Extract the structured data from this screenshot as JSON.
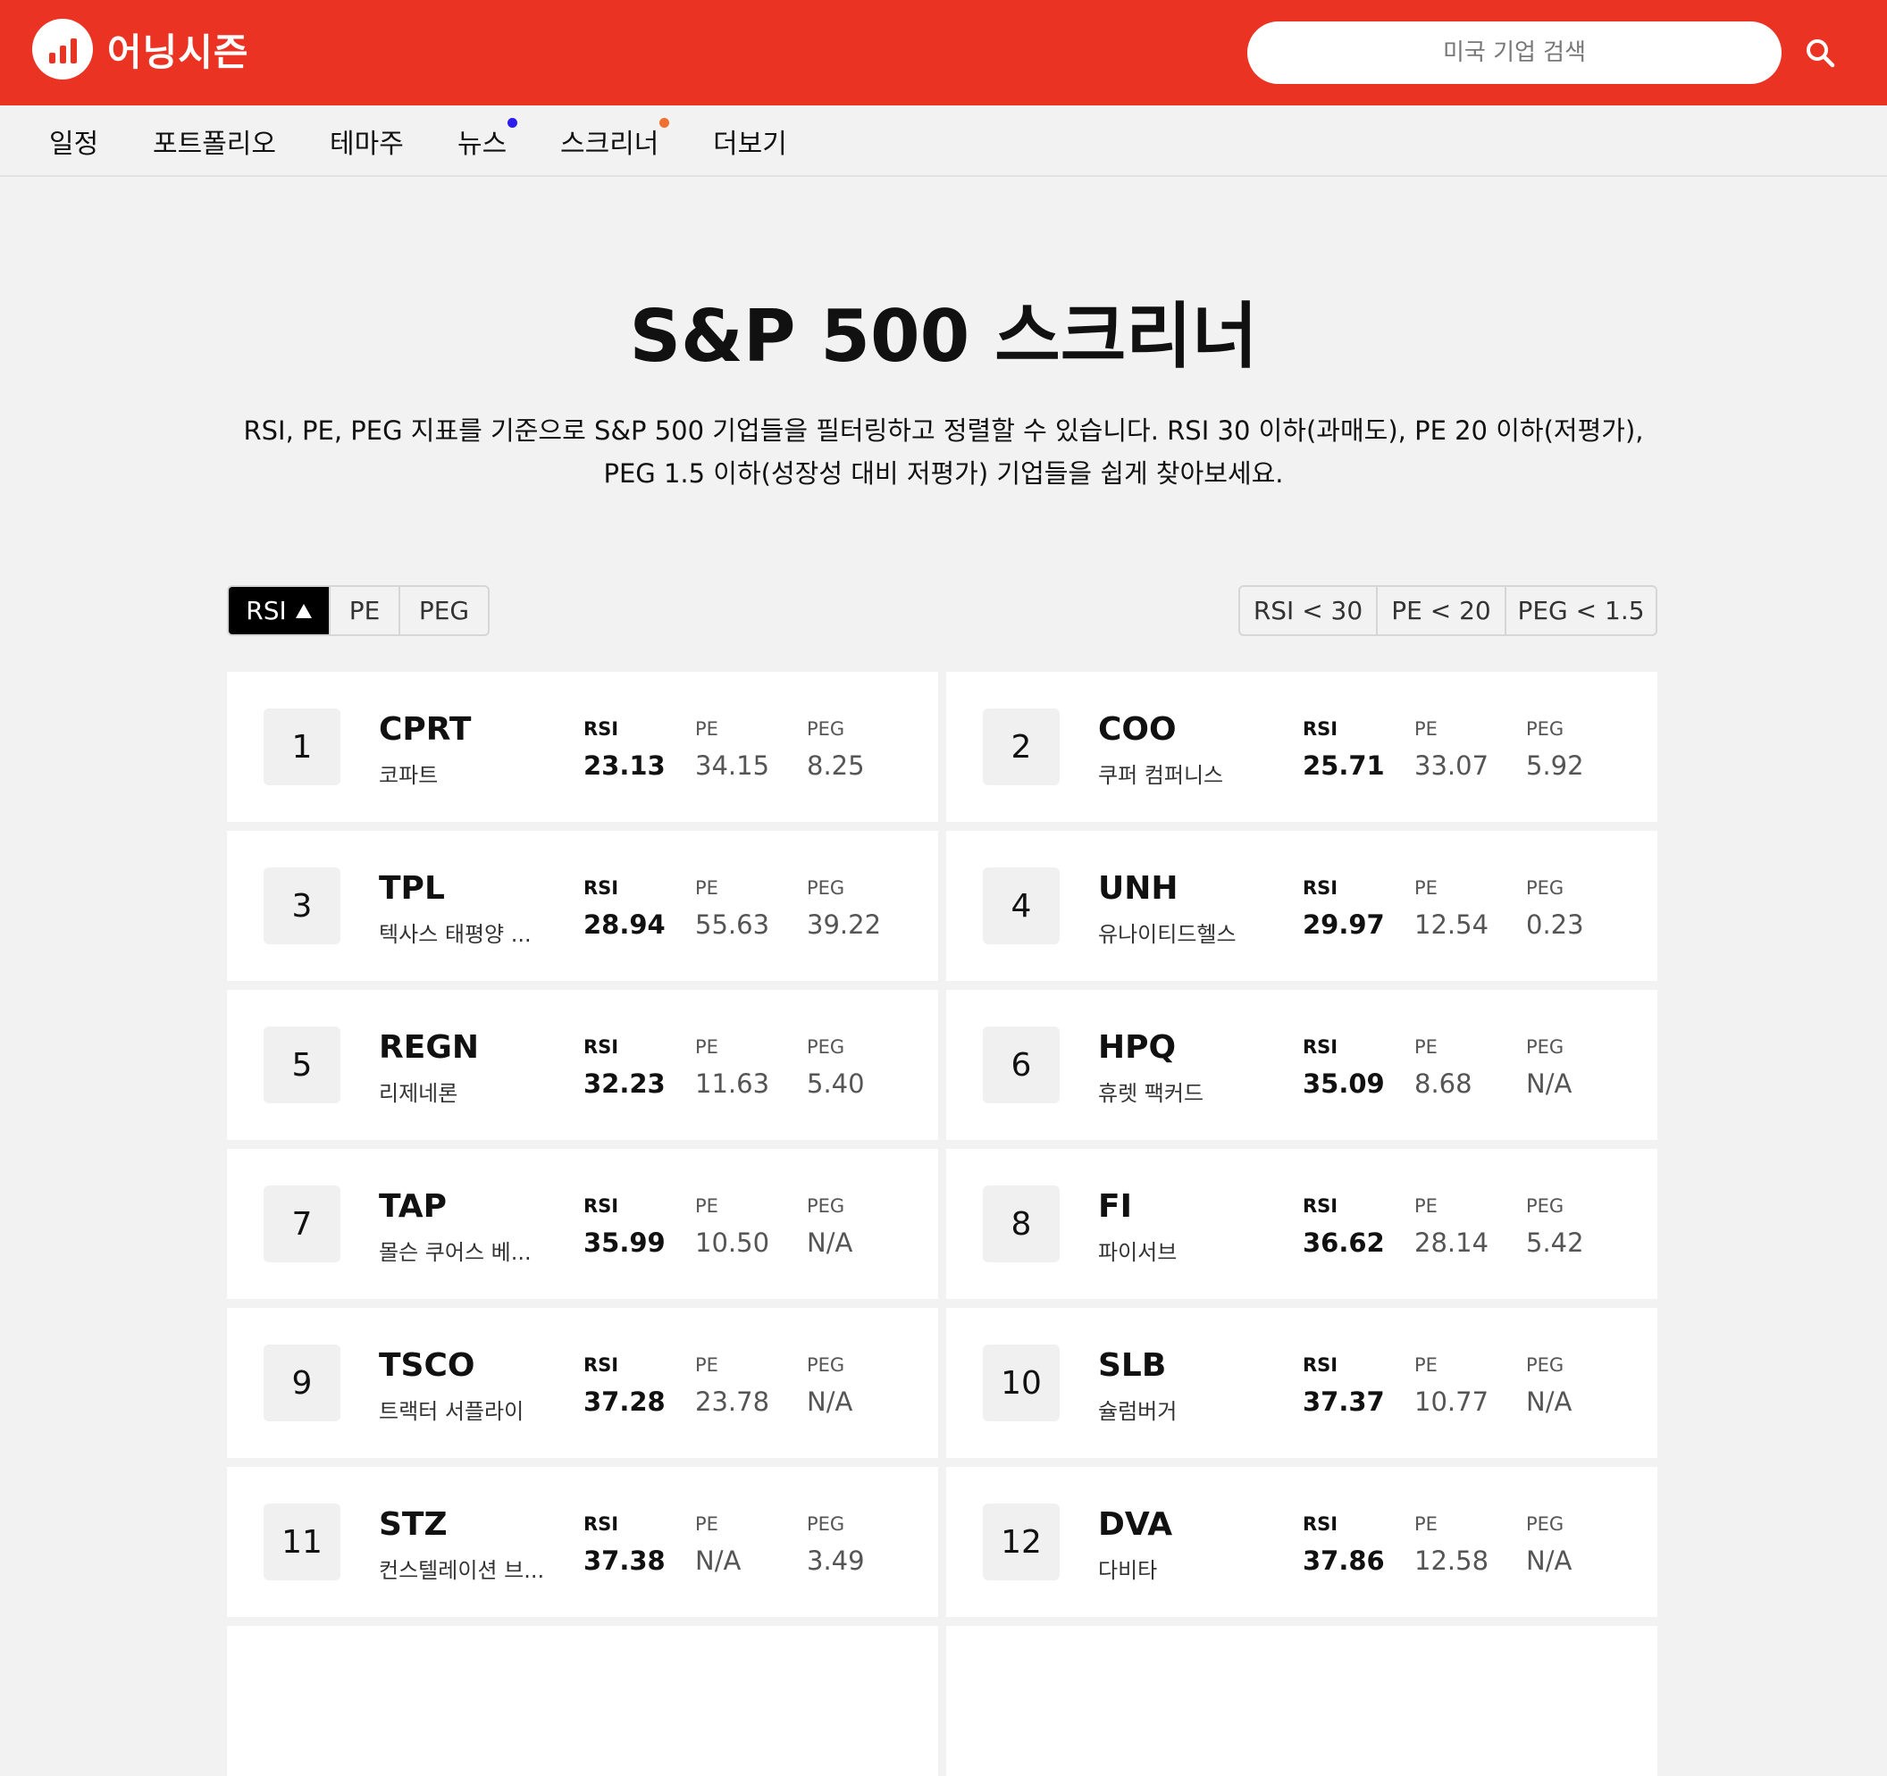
{
  "brand": {
    "name": "어닝시즌",
    "accent": "#ea3323"
  },
  "search": {
    "placeholder": "미국 기업 검색"
  },
  "nav": [
    {
      "label": "일정",
      "dot": null
    },
    {
      "label": "포트폴리오",
      "dot": null
    },
    {
      "label": "테마주",
      "dot": null
    },
    {
      "label": "뉴스",
      "dot": "#2b1cf0"
    },
    {
      "label": "스크리너",
      "dot": "#f07030"
    },
    {
      "label": "더보기",
      "dot": null
    }
  ],
  "page": {
    "title": "S&P 500 스크리너",
    "description": "RSI, PE, PEG 지표를 기준으로 S&P 500 기업들을 필터링하고 정렬할 수 있습니다. RSI 30 이하(과매도), PE 20 이하(저평가), PEG 1.5 이하(성장성 대비 저평가) 기업들을 쉽게 찾아보세요."
  },
  "sort": {
    "active": 0,
    "options": [
      "RSI",
      "PE",
      "PEG"
    ]
  },
  "filters": [
    "RSI < 30",
    "PE < 20",
    "PEG < 1.5"
  ],
  "labels": {
    "rsi": "RSI",
    "pe": "PE",
    "peg": "PEG"
  },
  "stocks": [
    {
      "rank": "1",
      "ticker": "CPRT",
      "name": "코파트",
      "rsi": "23.13",
      "pe": "34.15",
      "peg": "8.25"
    },
    {
      "rank": "2",
      "ticker": "COO",
      "name": "쿠퍼 컴퍼니스",
      "rsi": "25.71",
      "pe": "33.07",
      "peg": "5.92"
    },
    {
      "rank": "3",
      "ticker": "TPL",
      "name": "텍사스 태평양 ...",
      "rsi": "28.94",
      "pe": "55.63",
      "peg": "39.22"
    },
    {
      "rank": "4",
      "ticker": "UNH",
      "name": "유나이티드헬스",
      "rsi": "29.97",
      "pe": "12.54",
      "peg": "0.23"
    },
    {
      "rank": "5",
      "ticker": "REGN",
      "name": "리제네론",
      "rsi": "32.23",
      "pe": "11.63",
      "peg": "5.40"
    },
    {
      "rank": "6",
      "ticker": "HPQ",
      "name": "휴렛 팩커드",
      "rsi": "35.09",
      "pe": "8.68",
      "peg": "N/A"
    },
    {
      "rank": "7",
      "ticker": "TAP",
      "name": "몰슨 쿠어스 베...",
      "rsi": "35.99",
      "pe": "10.50",
      "peg": "N/A"
    },
    {
      "rank": "8",
      "ticker": "FI",
      "name": "파이서브",
      "rsi": "36.62",
      "pe": "28.14",
      "peg": "5.42"
    },
    {
      "rank": "9",
      "ticker": "TSCO",
      "name": "트랙터 서플라이",
      "rsi": "37.28",
      "pe": "23.78",
      "peg": "N/A"
    },
    {
      "rank": "10",
      "ticker": "SLB",
      "name": "슐럼버거",
      "rsi": "37.37",
      "pe": "10.77",
      "peg": "N/A"
    },
    {
      "rank": "11",
      "ticker": "STZ",
      "name": "컨스텔레이션 브...",
      "rsi": "37.38",
      "pe": "N/A",
      "peg": "3.49"
    },
    {
      "rank": "12",
      "ticker": "DVA",
      "name": "다비타",
      "rsi": "37.86",
      "pe": "12.58",
      "peg": "N/A"
    }
  ]
}
